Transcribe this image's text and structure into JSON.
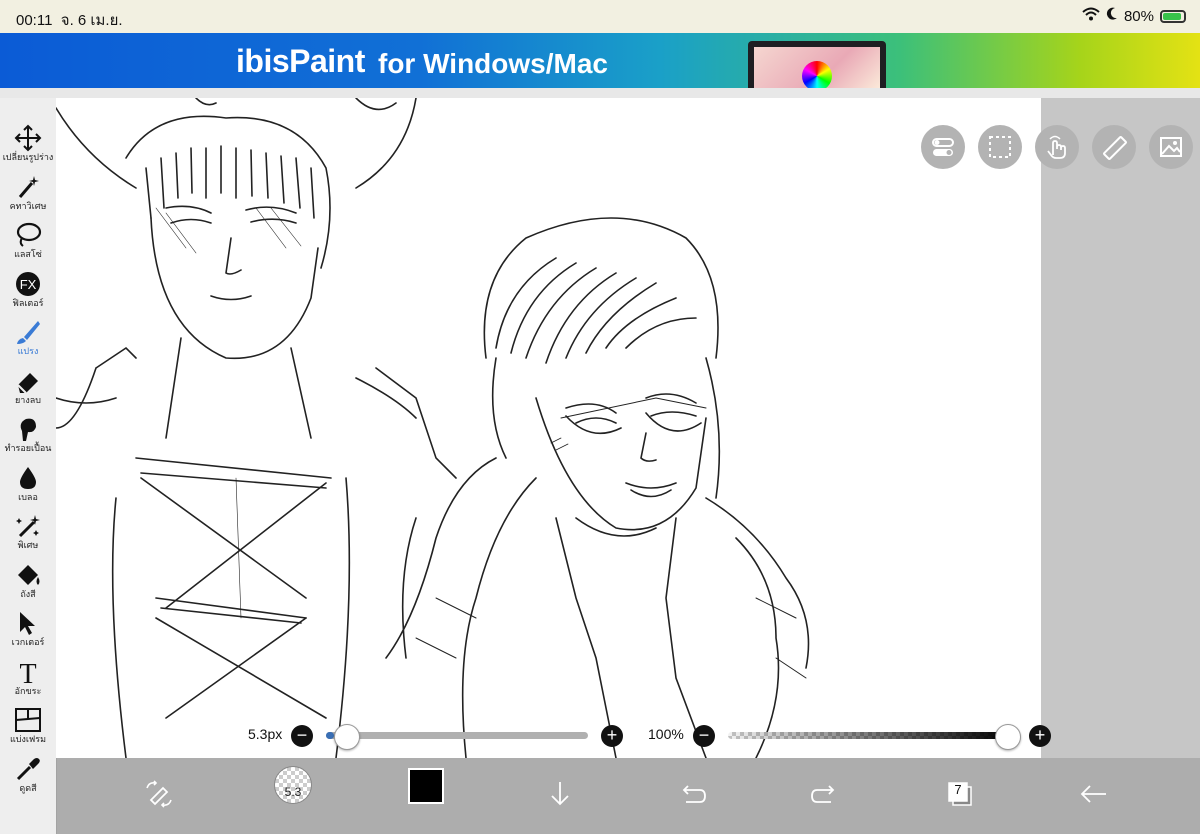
{
  "status_bar": {
    "time": "00:11",
    "date": "จ. 6 เม.ย.",
    "battery": "80%"
  },
  "banner": {
    "logo": "ibisPaint",
    "tagline": "for Windows/Mac"
  },
  "tools": [
    {
      "label": "เปลี่ยนรูปร่าง",
      "icon": "move-arrows-icon"
    },
    {
      "label": "คทาวิเศษ",
      "icon": "magic-wand-icon"
    },
    {
      "label": "แลสโซ่",
      "icon": "lasso-icon"
    },
    {
      "label": "ฟิลเตอร์",
      "icon": "fx-icon"
    },
    {
      "label": "แปรง",
      "icon": "brush-icon"
    },
    {
      "label": "ยางลบ",
      "icon": "eraser-icon"
    },
    {
      "label": "ทำรอยเปื้อน",
      "icon": "smudge-icon"
    },
    {
      "label": "เบลอ",
      "icon": "blur-drop-icon"
    },
    {
      "label": "พิเศษ",
      "icon": "sparkle-icon"
    },
    {
      "label": "ถังสี",
      "icon": "paint-bucket-icon"
    },
    {
      "label": "เวกเตอร์",
      "icon": "vector-cursor-icon"
    },
    {
      "label": "อักขระ",
      "icon": "text-icon"
    },
    {
      "label": "แบ่งเฟรม",
      "icon": "frame-divider-icon"
    },
    {
      "label": "ดูดสี",
      "icon": "eyedropper-icon"
    }
  ],
  "brush": {
    "size_label": "5.3px",
    "size_fraction": 0.03,
    "opacity_label": "100%",
    "opacity_fraction": 1.0,
    "thumb_value": "5.3"
  },
  "layers": {
    "count": "7"
  },
  "colors": {
    "active_tool": "#3a7bd5",
    "current_color": "#000000",
    "slider_fill": "#3a6fb5"
  }
}
